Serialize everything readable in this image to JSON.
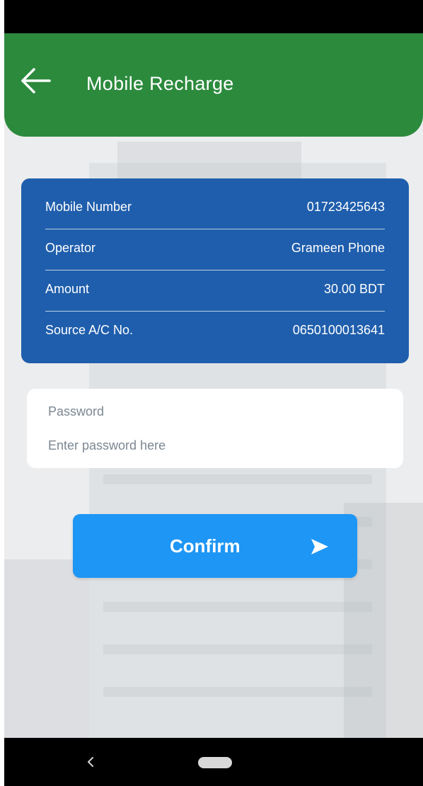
{
  "header": {
    "title": "Mobile Recharge",
    "back_icon": "arrow-left-icon",
    "color": "#2c8a3d"
  },
  "summary": {
    "color": "#1f5eac",
    "rows": [
      {
        "label": "Mobile Number",
        "value": "01723425643"
      },
      {
        "label": "Operator",
        "value": "Grameen Phone"
      },
      {
        "label": "Amount",
        "value": "30.00 BDT"
      },
      {
        "label": "Source A/C No.",
        "value": "0650100013641"
      }
    ]
  },
  "password": {
    "label": "Password",
    "placeholder": "Enter password here",
    "value": ""
  },
  "confirm": {
    "label": "Confirm",
    "icon": "send-icon",
    "color": "#1e96f5"
  },
  "navbar": {
    "back_icon": "nav-back-icon",
    "home_icon": "nav-home-pill"
  }
}
